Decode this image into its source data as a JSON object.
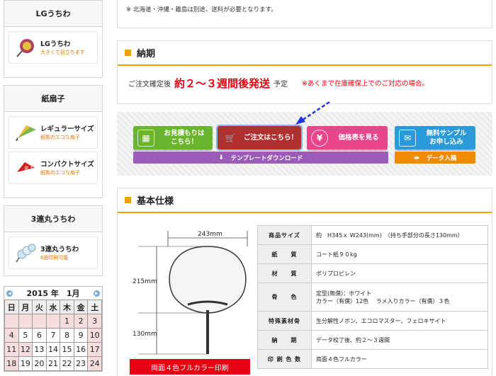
{
  "sidebar": {
    "lg": {
      "heading": "LGうちわ",
      "item_title": "LGうちわ",
      "item_sub": "大きくて目立ちます"
    },
    "paper": {
      "heading": "紙扇子",
      "items": [
        {
          "title": "レギュラーサイズ",
          "sub": "紙製のエコな扇子"
        },
        {
          "title": "コンパクトサイズ",
          "sub": "紙製のエコな扇子"
        }
      ]
    },
    "triple": {
      "heading": "3連丸うちわ",
      "item_title": "3連丸うちわ",
      "item_sub": "6面印刷可能"
    }
  },
  "calendar": {
    "title": "2015 年　1月",
    "weekdays": [
      "日",
      "月",
      "火",
      "水",
      "木",
      "金",
      "土"
    ],
    "rows": [
      [
        "",
        "",
        "",
        "",
        "1",
        "2",
        "3"
      ],
      [
        "4",
        "5",
        "6",
        "7",
        "8",
        "9",
        "10"
      ],
      [
        "11",
        "12",
        "13",
        "14",
        "15",
        "16",
        "17"
      ],
      [
        "18",
        "19",
        "20",
        "21",
        "22",
        "23",
        "24"
      ]
    ]
  },
  "top_notes": [
    "※ 北海道・沖縄・離島は別途、送料が必要となります。"
  ],
  "delivery": {
    "heading": "納期",
    "prefix": "ご注文確定後",
    "highlight": "約２～３週間後発送",
    "suffix": "予定",
    "note": "※あくまで在庫確保上でのご対応の場合。"
  },
  "buttons": {
    "estimate": "お見積もりは\nこちら！",
    "order": "ご注文はこちら！",
    "price": "価格表を見る",
    "sample": "無料サンプル\nお申し込み",
    "template": "テンプレートダウンロード",
    "data": "データ入稿"
  },
  "spec": {
    "heading": "基本仕様",
    "diagram": {
      "width": "243mm",
      "height_upper": "215mm",
      "height_lower": "130mm"
    },
    "print_label": "両面４色フルカラー印刷",
    "rows": [
      {
        "key": "商品サイズ",
        "value": "約　H345ｘ W243(mm)　（持ち手部分の長さ130mm）"
      },
      {
        "key": "紙　　質",
        "value": "コート紙９０kg"
      },
      {
        "key": "材　　質",
        "value": "ポリプロピレン"
      },
      {
        "key": "骨　　色",
        "value": "定型(無償)：ホワイト\nカラー（有償）12色　 ラメ入りカラー（有償）３色"
      },
      {
        "key": "特殊素材骨",
        "value": "生分解性ノボン、エコロマスター、フェロキサイト"
      },
      {
        "key": "納　　期",
        "value": "データ校了後、約２～３週間"
      },
      {
        "key": "印 刷 色 数",
        "value": "両面４色フルカラー"
      }
    ]
  },
  "colors": {
    "accent": "#f0a000",
    "red": "#e60012",
    "green": "#6bb52e",
    "darkred": "#b03030",
    "pink": "#e8458b",
    "blue": "#2a9ad8",
    "purple": "#9a5cb6",
    "orange": "#f08a00"
  }
}
